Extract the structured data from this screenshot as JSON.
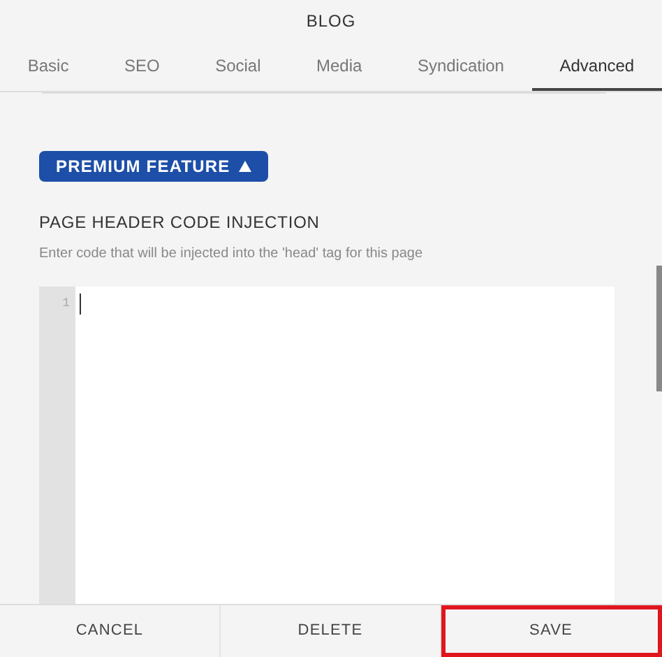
{
  "window": {
    "title": "BLOG"
  },
  "tabs": [
    {
      "label": "Basic",
      "selected": false
    },
    {
      "label": "SEO",
      "selected": false
    },
    {
      "label": "Social",
      "selected": false
    },
    {
      "label": "Media",
      "selected": false
    },
    {
      "label": "Syndication",
      "selected": false
    },
    {
      "label": "Advanced",
      "selected": true
    }
  ],
  "premium_badge": {
    "label": "PREMIUM FEATURE",
    "expanded": true
  },
  "section": {
    "title": "PAGE HEADER CODE INJECTION",
    "description": "Enter code that will be injected into the 'head' tag for this page"
  },
  "code_editor": {
    "line_numbers": [
      "1"
    ]
  },
  "buttons": [
    {
      "label": "CANCEL",
      "highlighted": false
    },
    {
      "label": "DELETE",
      "highlighted": false
    },
    {
      "label": "SAVE",
      "highlighted": true
    }
  ]
}
